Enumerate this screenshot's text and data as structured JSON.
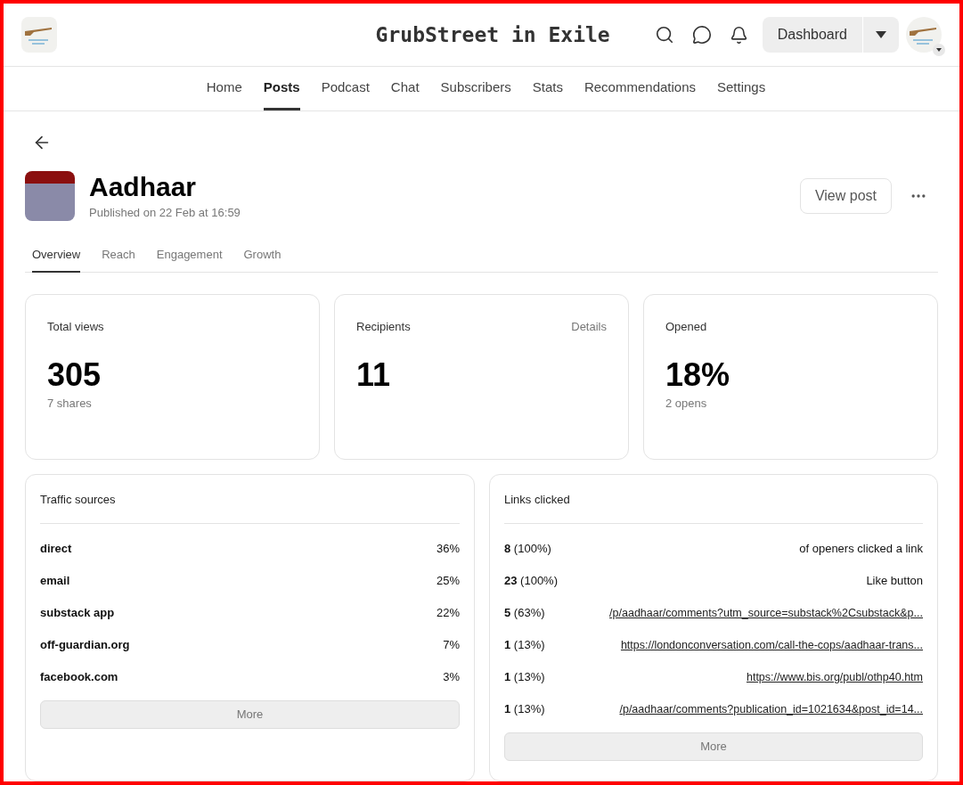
{
  "header": {
    "title": "GrubStreet in Exile",
    "dashboard_button": "Dashboard"
  },
  "nav": [
    {
      "label": "Home",
      "selected": false
    },
    {
      "label": "Posts",
      "selected": true
    },
    {
      "label": "Podcast",
      "selected": false
    },
    {
      "label": "Chat",
      "selected": false
    },
    {
      "label": "Subscribers",
      "selected": false
    },
    {
      "label": "Stats",
      "selected": false
    },
    {
      "label": "Recommendations",
      "selected": false
    },
    {
      "label": "Settings",
      "selected": false
    }
  ],
  "post": {
    "title": "Aadhaar",
    "published": "Published on 22 Feb at 16:59",
    "view_button": "View post"
  },
  "tabs": [
    {
      "label": "Overview",
      "selected": true
    },
    {
      "label": "Reach",
      "selected": false
    },
    {
      "label": "Engagement",
      "selected": false
    },
    {
      "label": "Growth",
      "selected": false
    }
  ],
  "stats": [
    {
      "label": "Total views",
      "value": "305",
      "sub": "7 shares"
    },
    {
      "label": "Recipients",
      "value": "11",
      "action": "Details"
    },
    {
      "label": "Opened",
      "value": "18%",
      "sub": "2 opens"
    }
  ],
  "traffic_sources": {
    "title": "Traffic sources",
    "more_button": "More",
    "rows": [
      {
        "name": "direct",
        "share": "36%"
      },
      {
        "name": "email",
        "share": "25%"
      },
      {
        "name": "substack app",
        "share": "22%"
      },
      {
        "name": "off-guardian.org",
        "share": "7%"
      },
      {
        "name": "facebook.com",
        "share": "3%"
      }
    ]
  },
  "links_clicked": {
    "title": "Links clicked",
    "more_button": "More",
    "rows": [
      {
        "count": "8",
        "percent": "(100%)",
        "kind": "text",
        "label": "of openers clicked a link"
      },
      {
        "count": "23",
        "percent": "(100%)",
        "kind": "text",
        "label": "Like button"
      },
      {
        "count": "5",
        "percent": "(63%)",
        "kind": "link",
        "label": "/p/aadhaar/comments?utm_source=substack%2Csubstack&p..."
      },
      {
        "count": "1",
        "percent": "(13%)",
        "kind": "link",
        "label": "https://londonconversation.com/call-the-cops/aadhaar-trans..."
      },
      {
        "count": "1",
        "percent": "(13%)",
        "kind": "link",
        "label": "https://www.bis.org/publ/othp40.htm"
      },
      {
        "count": "1",
        "percent": "(13%)",
        "kind": "link",
        "label": "/p/aadhaar/comments?publication_id=1021634&post_id=14..."
      }
    ]
  }
}
